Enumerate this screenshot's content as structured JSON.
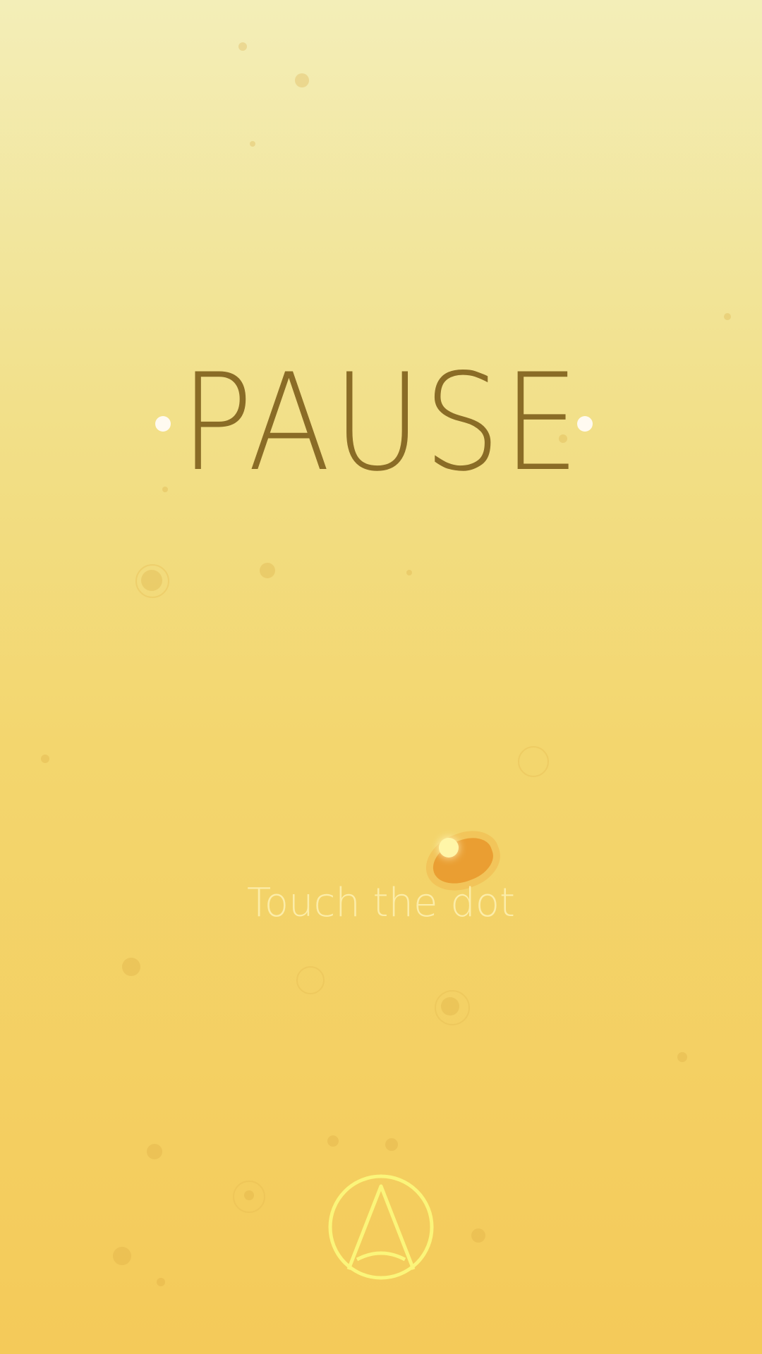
{
  "screen": {
    "title": "PAUSE",
    "hint": "Touch the dot"
  },
  "colors": {
    "title": "#8a6c26",
    "hint": "#fff6be",
    "logo": "#fbf57a",
    "accent_blob": "#e89428"
  },
  "icons": {
    "logo": "a-circle-logo-icon"
  }
}
